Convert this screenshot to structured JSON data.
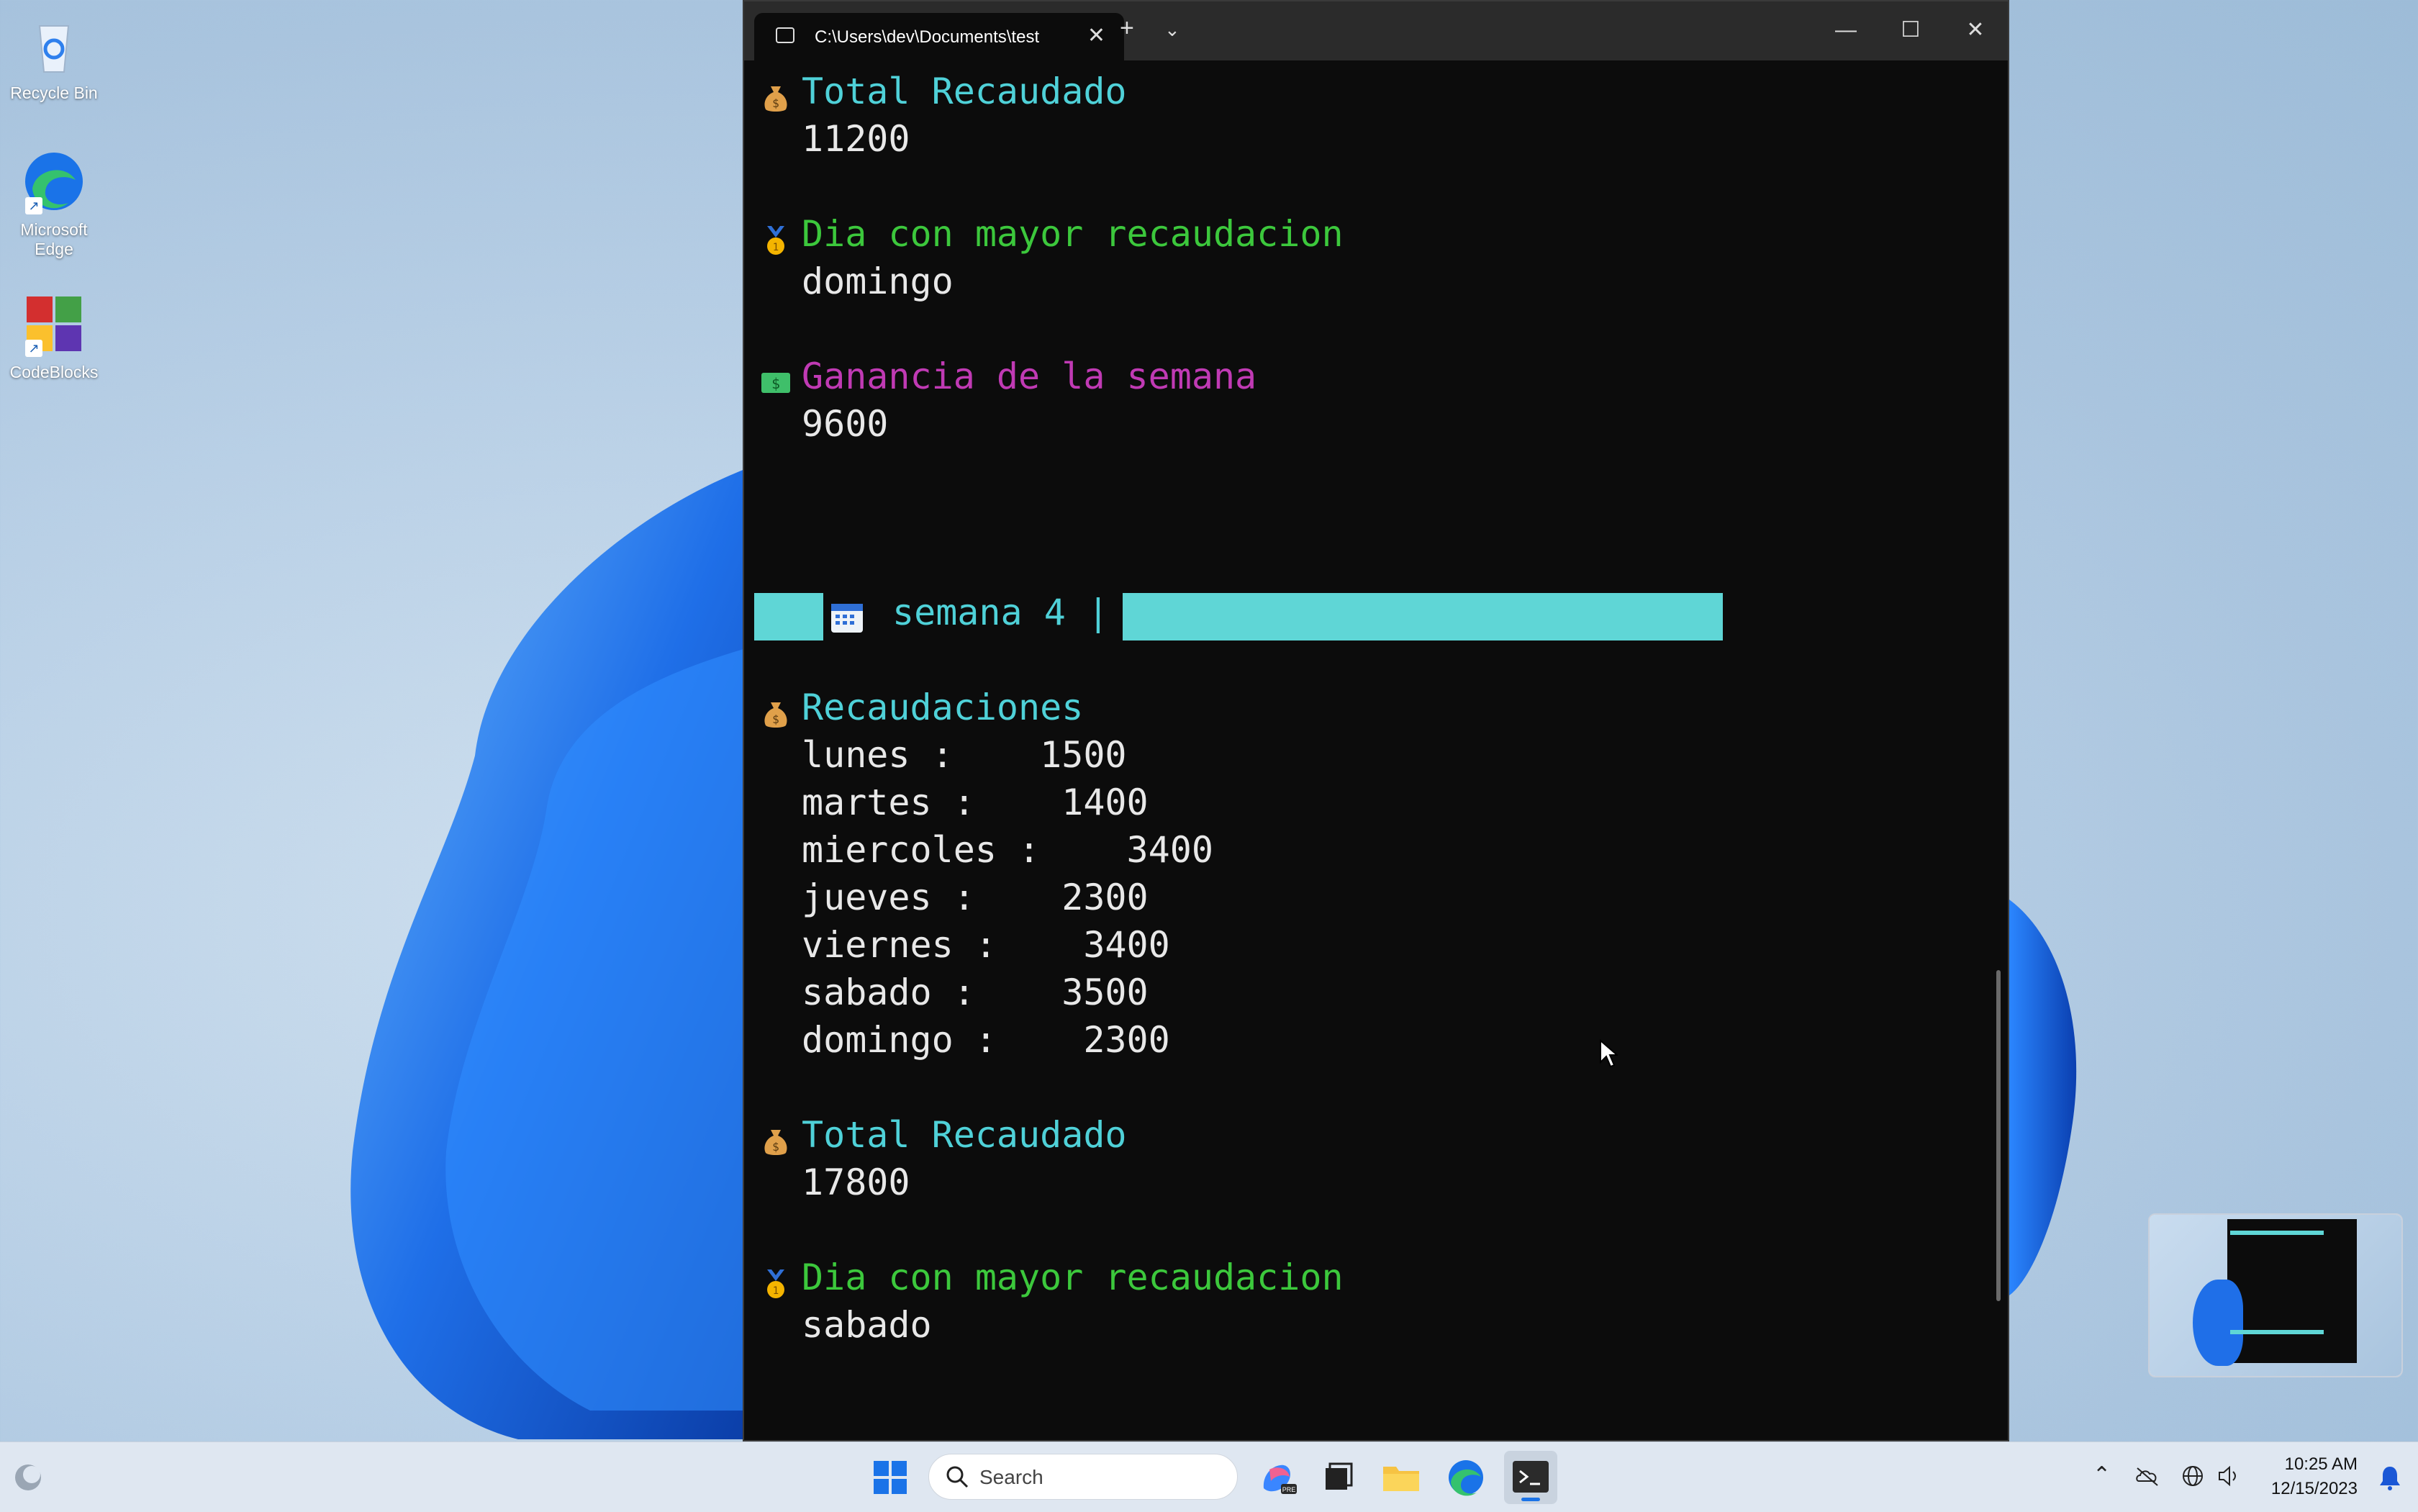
{
  "desktop": {
    "icons": [
      {
        "label": "Recycle Bin"
      },
      {
        "label": "Microsoft Edge"
      },
      {
        "label": "CodeBlocks"
      }
    ]
  },
  "terminal": {
    "tab_title": "C:\\Users\\dev\\Documents\\test",
    "lines": {
      "total_label_1": "Total Recaudado",
      "total_value_1": "11200",
      "best_day_label_1": "Dia con mayor recaudacion",
      "best_day_value_1": "domingo",
      "profit_label": "Ganancia de la semana",
      "profit_value": "9600",
      "week_header": "semana 4 |",
      "collections_label": "Recaudaciones",
      "days": [
        "lunes :    1500",
        "martes :    1400",
        "miercoles :    3400",
        "jueves :    2300",
        "viernes :    3400",
        "sabado :    3500",
        "domingo :    2300"
      ],
      "total_label_2": "Total Recaudado",
      "total_value_2": "17800",
      "best_day_label_2": "Dia con mayor recaudacion",
      "best_day_value_2": "sabado"
    }
  },
  "taskbar": {
    "search_placeholder": "Search",
    "time": "10:25 AM",
    "date": "12/15/2023"
  },
  "colors": {
    "cyan": "#4fd1d8",
    "green": "#3cc83c",
    "magenta": "#c03ab4",
    "terminal_bg": "#0c0c0c"
  }
}
